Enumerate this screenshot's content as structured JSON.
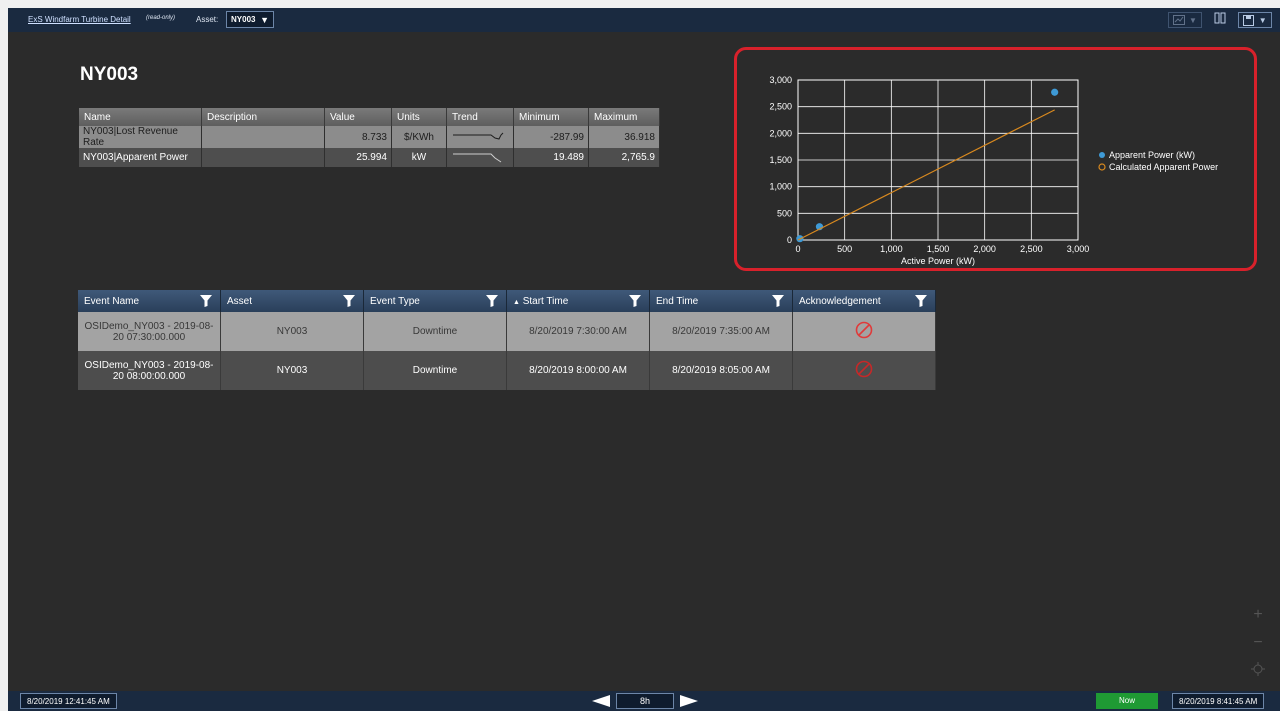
{
  "header": {
    "title": "ExS Windfarm Turbine Detail",
    "mode": "(read-only)",
    "asset_label": "Asset:",
    "asset_value": "NY003"
  },
  "asset_title": "NY003",
  "attributes": {
    "columns": [
      "Name",
      "Description",
      "Value",
      "Units",
      "Trend",
      "Minimum",
      "Maximum"
    ],
    "rows": [
      {
        "name": "NY003|Lost Revenue Rate",
        "description": "",
        "value": "8.733",
        "units": "$/KWh",
        "minimum": "-287.99",
        "maximum": "36.918"
      },
      {
        "name": "NY003|Apparent Power",
        "description": "",
        "value": "25.994",
        "units": "kW",
        "minimum": "19.489",
        "maximum": "2,765.9"
      }
    ]
  },
  "chart_data": {
    "type": "scatter",
    "xlabel": "Active Power (kW)",
    "ylabel": "",
    "xlim": [
      0,
      3000
    ],
    "ylim": [
      0,
      3000
    ],
    "xticks": [
      "0",
      "500",
      "1,000",
      "1,500",
      "2,000",
      "2,500",
      "3,000"
    ],
    "yticks": [
      "0",
      "500",
      "1,000",
      "1,500",
      "2,000",
      "2,500",
      "3,000"
    ],
    "grid": true,
    "legend_position": "right",
    "series": [
      {
        "name": "Apparent Power (kW)",
        "kind": "scatter",
        "color": "#3e9ad6",
        "points": [
          [
            20,
            25
          ],
          [
            230,
            250
          ],
          [
            2750,
            2770
          ]
        ]
      },
      {
        "name": "Calculated Apparent Power",
        "kind": "line",
        "color": "#d8891f",
        "points": [
          [
            0,
            0
          ],
          [
            2750,
            2440
          ]
        ]
      }
    ]
  },
  "events": {
    "columns": [
      "Event Name",
      "Asset",
      "Event Type",
      "Start Time",
      "End Time",
      "Acknowledgement"
    ],
    "sort_indicator": "▲",
    "rows": [
      {
        "name_line1": "OSIDemo_NY003 - 2019-08-",
        "name_line2": "20 07:30:00.000",
        "asset": "NY003",
        "type": "Downtime",
        "start": "8/20/2019 7:30:00 AM",
        "end": "8/20/2019 7:35:00 AM",
        "ack_icon": "no-entry-icon"
      },
      {
        "name_line1": "OSIDemo_NY003 - 2019-08-",
        "name_line2": "20 08:00:00.000",
        "asset": "NY003",
        "type": "Downtime",
        "start": "8/20/2019 8:00:00 AM",
        "end": "8/20/2019 8:05:00 AM",
        "ack_icon": "no-entry-icon"
      }
    ]
  },
  "timebar": {
    "start": "8/20/2019 12:41:45 AM",
    "span": "8h",
    "now_label": "Now",
    "end": "8/20/2019 8:41:45 AM"
  },
  "colors": {
    "highlight_border": "#d8212b",
    "header_bg": "#1a2a40",
    "now_green": "#1f9a34",
    "ack_red": "#e03a3a"
  }
}
